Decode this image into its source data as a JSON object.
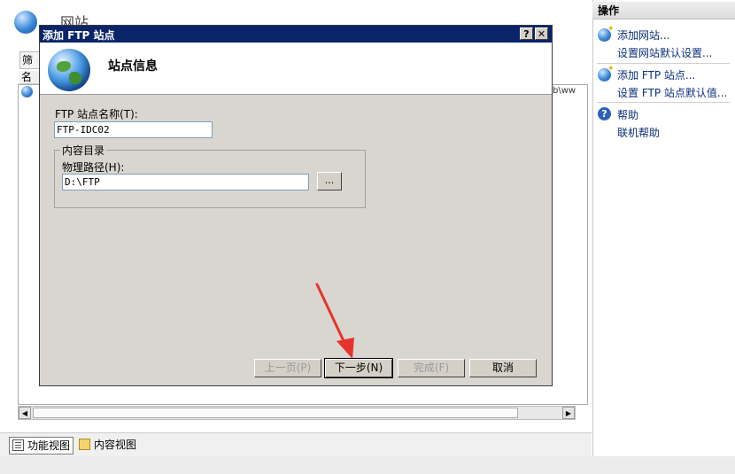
{
  "background": {
    "page_title": "网站",
    "filter_label": "筛选",
    "column_header": "名称",
    "row_path_fragment": "b\\ww",
    "view_tabs": {
      "feature_view": "功能视图",
      "content_view": "内容视图"
    }
  },
  "actions_pane": {
    "header": "操作",
    "items": [
      {
        "label": "添加网站...",
        "icon": "globe-add-icon"
      },
      {
        "label": "设置网站默认设置...",
        "icon": ""
      },
      {
        "label": "添加 FTP 站点...",
        "icon": "globe-add-icon"
      },
      {
        "label": "设置 FTP 站点默认值...",
        "icon": ""
      },
      {
        "label": "帮助",
        "icon": "help-icon"
      },
      {
        "label": "联机帮助",
        "icon": ""
      }
    ]
  },
  "dialog": {
    "title": "添加 FTP 站点",
    "help_button": "?",
    "close_button": "✕",
    "heading": "站点信息",
    "site_name_label": "FTP 站点名称(T):",
    "site_name_value": "FTP-IDC02",
    "content_group_label": "内容目录",
    "path_label": "物理路径(H):",
    "path_value": "D:\\FTP",
    "browse_button": "...",
    "buttons": {
      "prev": "上一页(P)",
      "next": "下一步(N)",
      "finish": "完成(F)",
      "cancel": "取消"
    }
  },
  "colors": {
    "title_bar": "#0a246a",
    "dialog_face": "#d9d6d0",
    "annotation_arrow": "#e8322e"
  }
}
